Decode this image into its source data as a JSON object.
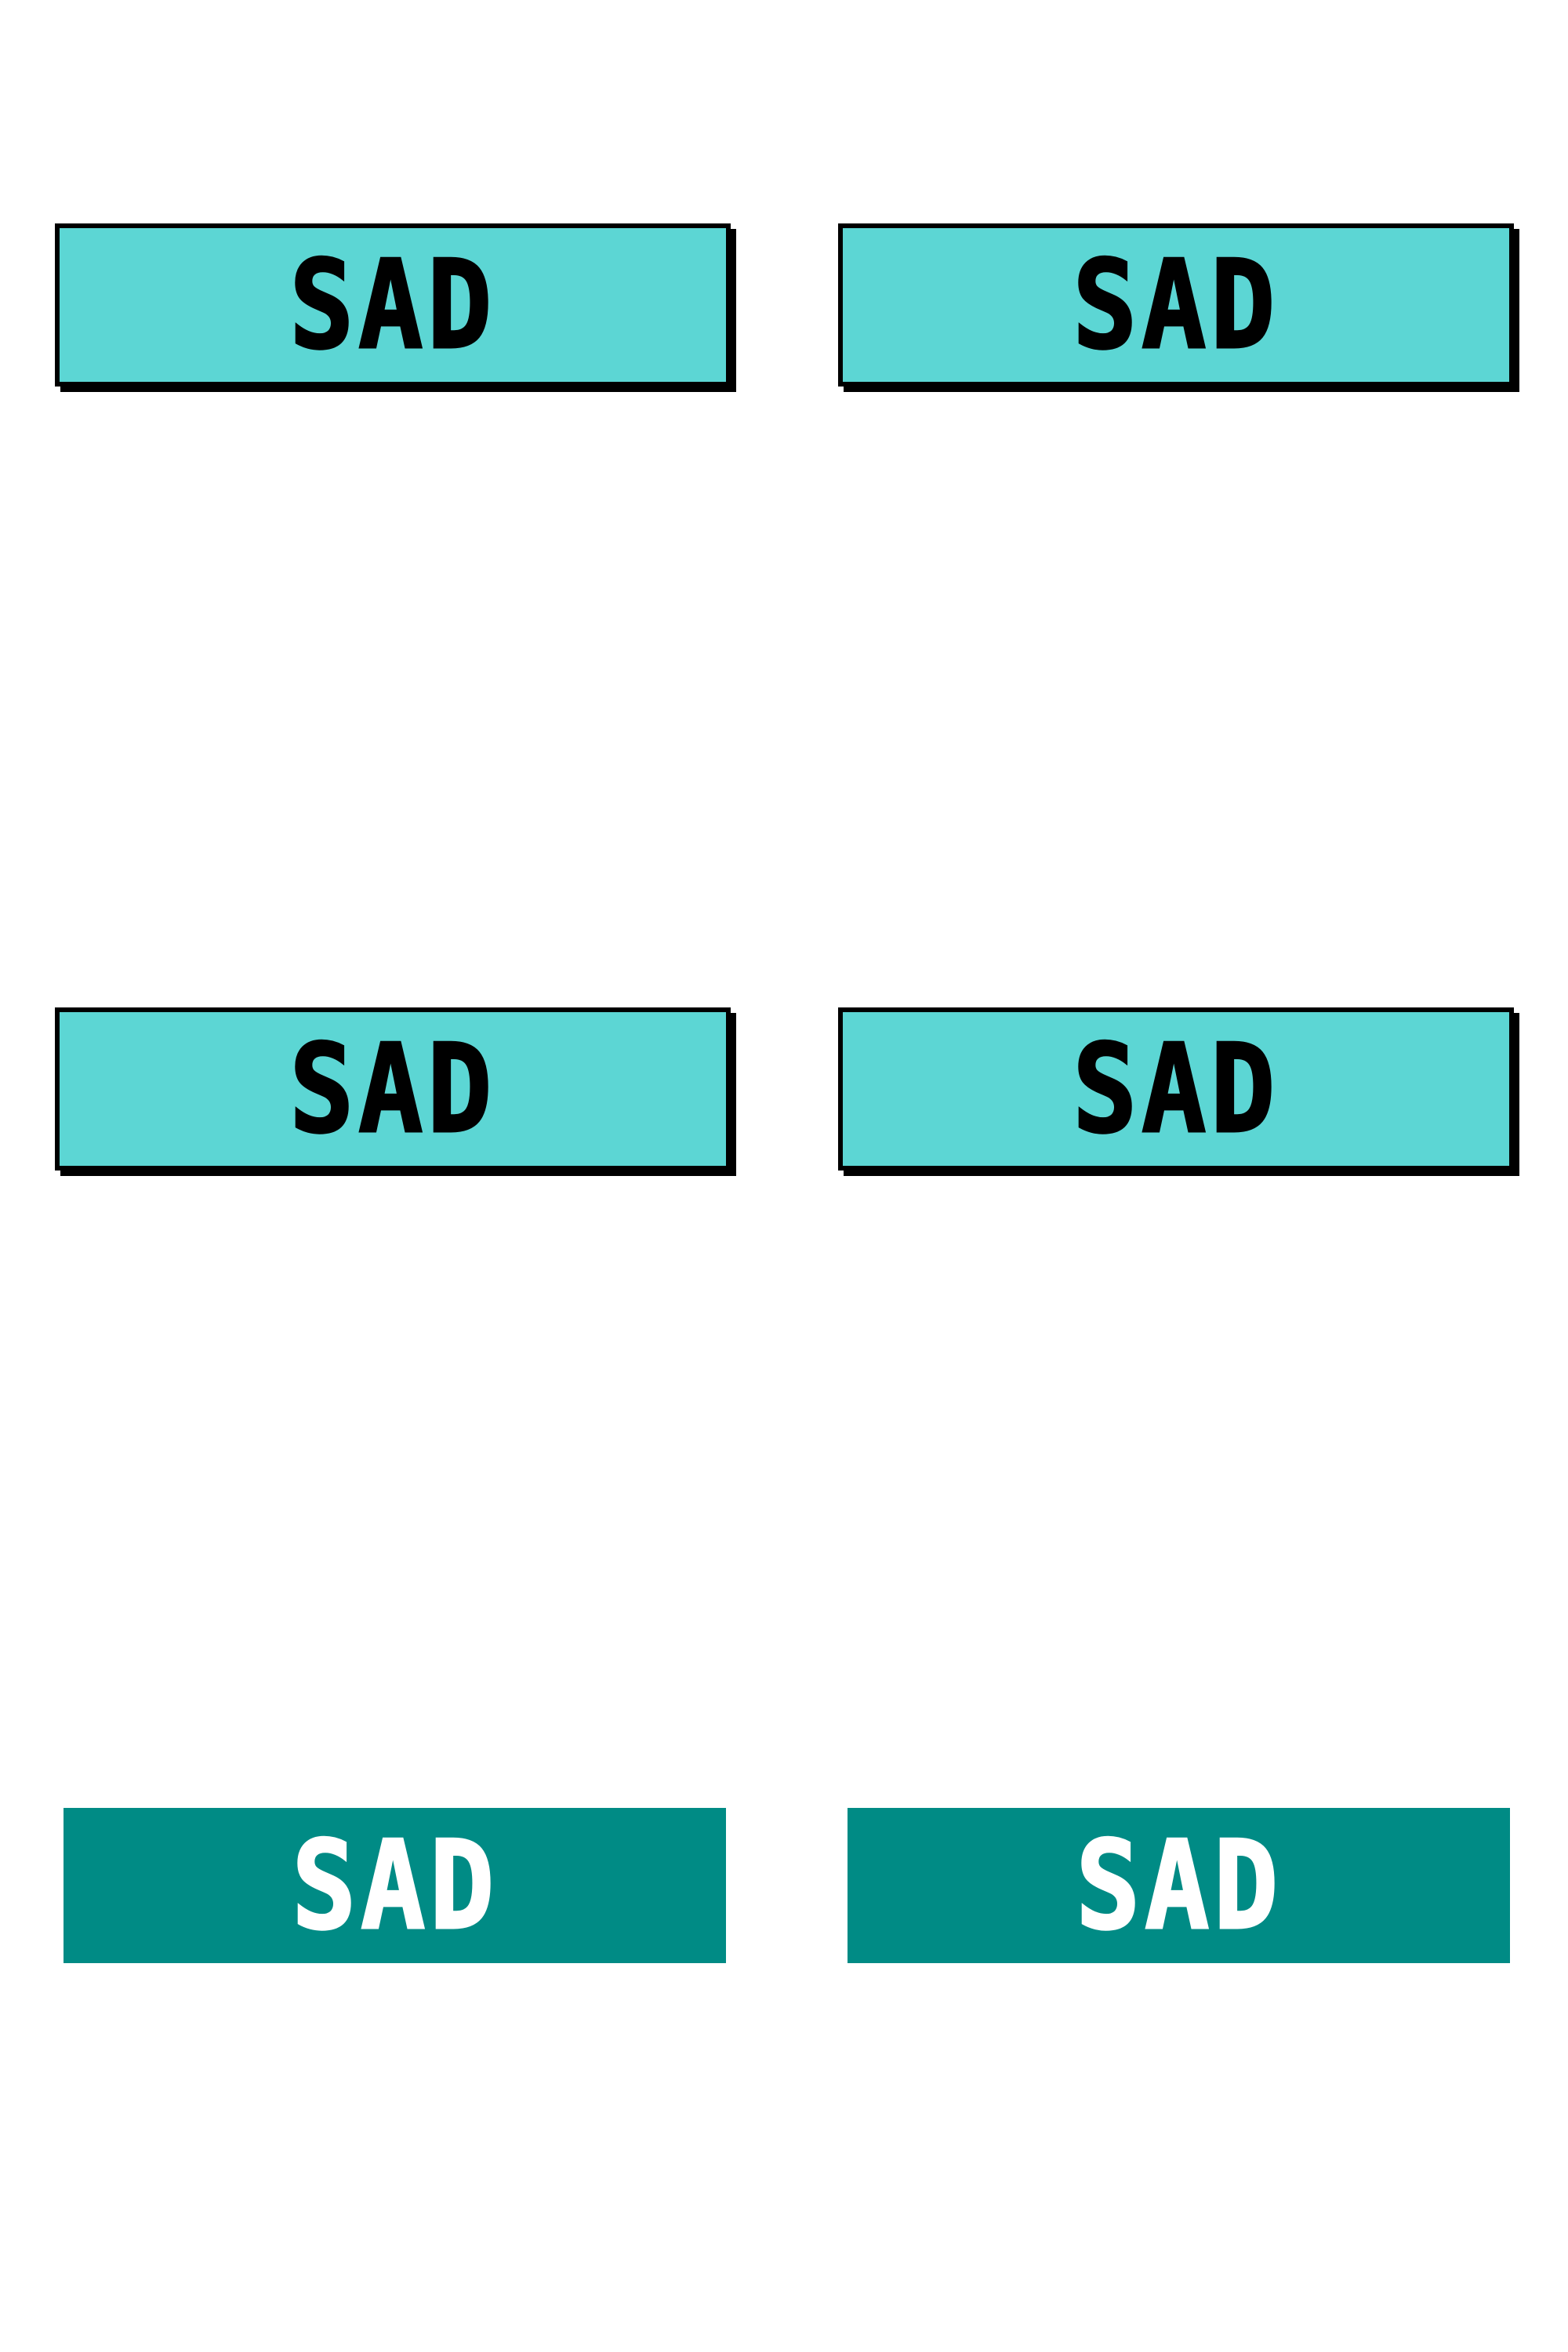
{
  "colors": {
    "background": "#ffffff",
    "light_tile": "#5cd6d4",
    "light_tile_text": "#000000",
    "light_tile_border": "#000000",
    "dark_tile": "#008b85",
    "dark_tile_text": "#ffffff"
  },
  "tiles": [
    {
      "label": "SAD",
      "style": "outlined-light"
    },
    {
      "label": "SAD",
      "style": "outlined-light"
    },
    {
      "label": "SAD",
      "style": "outlined-light"
    },
    {
      "label": "SAD",
      "style": "outlined-light"
    },
    {
      "label": "SAD",
      "style": "flat-dark"
    },
    {
      "label": "SAD",
      "style": "flat-dark"
    }
  ]
}
